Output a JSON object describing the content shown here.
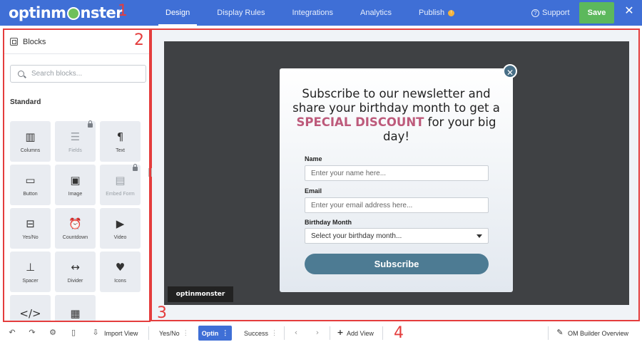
{
  "app": {
    "logo_before": "optinm",
    "logo_after": "nster",
    "annotations": [
      "1",
      "2",
      "3",
      "4"
    ]
  },
  "nav": {
    "tabs": [
      {
        "label": "Design",
        "active": true
      },
      {
        "label": "Display Rules",
        "active": false
      },
      {
        "label": "Integrations",
        "active": false
      },
      {
        "label": "Analytics",
        "active": false
      },
      {
        "label": "Publish",
        "active": false
      }
    ],
    "publish_badge": "!",
    "support": "Support",
    "save": "Save",
    "close": "✕"
  },
  "sidebar": {
    "title": "Blocks",
    "search_placeholder": "Search blocks...",
    "section": "Standard",
    "blocks": [
      {
        "label": "Columns",
        "icon": "columns-icon",
        "glyph": "▥",
        "locked": false
      },
      {
        "label": "Fields",
        "icon": "fields-icon",
        "glyph": "☰",
        "locked": true
      },
      {
        "label": "Text",
        "icon": "paragraph-icon",
        "glyph": "¶",
        "locked": false
      },
      {
        "label": "Button",
        "icon": "button-icon",
        "glyph": "▭",
        "locked": false
      },
      {
        "label": "Image",
        "icon": "image-icon",
        "glyph": "▣",
        "locked": false
      },
      {
        "label": "Embed Form",
        "icon": "embed-form-icon",
        "glyph": "▤",
        "locked": true
      },
      {
        "label": "Yes/No",
        "icon": "yes-no-icon",
        "glyph": "⊟",
        "locked": false
      },
      {
        "label": "Countdown",
        "icon": "alarm-clock-icon",
        "glyph": "⏰",
        "locked": false
      },
      {
        "label": "Video",
        "icon": "video-camera-icon",
        "glyph": "▶",
        "locked": false
      },
      {
        "label": "Spacer",
        "icon": "spacer-icon",
        "glyph": "⊥",
        "locked": false
      },
      {
        "label": "Divider",
        "icon": "divider-icon",
        "glyph": "↔",
        "locked": false
      },
      {
        "label": "Icons",
        "icon": "heart-icon",
        "glyph": "♥",
        "locked": false
      },
      {
        "label": "",
        "icon": "code-icon",
        "glyph": "</>",
        "locked": false
      },
      {
        "label": "",
        "icon": "calendar-icon",
        "glyph": "▦",
        "locked": false
      }
    ]
  },
  "popup": {
    "headline_pre": "Subscribe to our newsletter and share your birthday month to get a ",
    "headline_highlight": "SPECIAL DISCOUNT",
    "headline_post": " for your big day!",
    "name_label": "Name",
    "name_placeholder": "Enter your name here...",
    "email_label": "Email",
    "email_placeholder": "Enter your email address here...",
    "birthday_label": "Birthday Month",
    "birthday_value": "Select your birthday month...",
    "subscribe": "Subscribe",
    "close": "✕",
    "watermark": "optinmonster",
    "highlight_color": "#bd5a7b",
    "button_color": "#4d7b93"
  },
  "bottom": {
    "import_view": "Import View",
    "views": [
      {
        "label": "Yes/No",
        "active": false
      },
      {
        "label": "Optin",
        "active": true
      },
      {
        "label": "Success",
        "active": false
      }
    ],
    "add_view": "Add View",
    "overview": "OM Builder Overview"
  },
  "colors": {
    "brand_blue": "#3f6fd6",
    "save_green": "#5cb85c",
    "annotation_red": "#e43d3d"
  }
}
